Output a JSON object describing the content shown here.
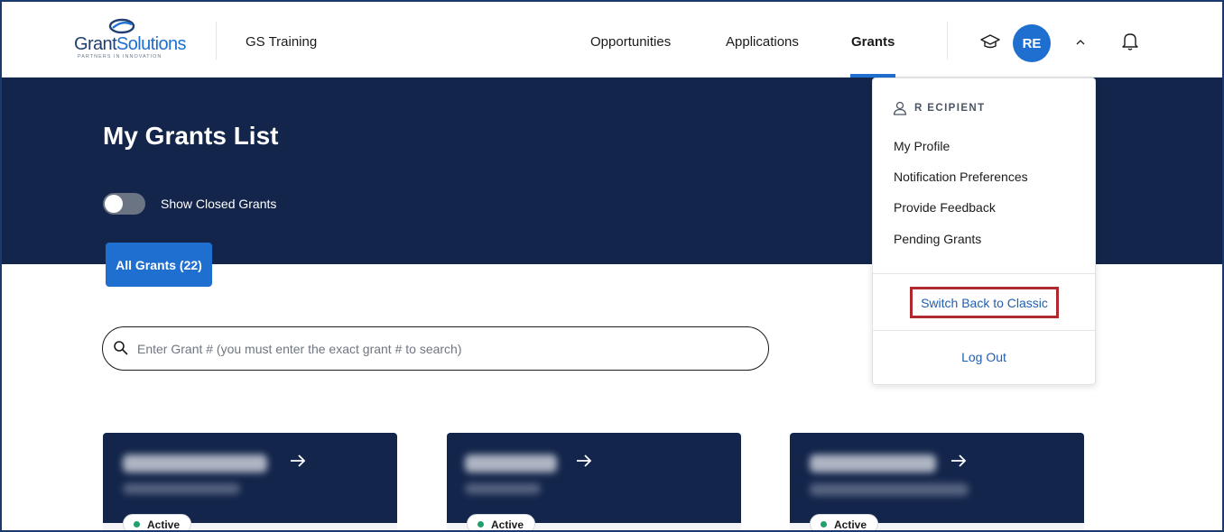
{
  "header": {
    "logo_text_a": "Grant",
    "logo_text_b": "Solutions",
    "logo_tagline": "PARTNERS IN INNOVATION",
    "app_name": "GS Training",
    "nav": [
      {
        "label": "Opportunities"
      },
      {
        "label": "Applications"
      },
      {
        "label": "Grants",
        "active": true
      }
    ],
    "avatar_initials": "RE",
    "icons": [
      "graduation-cap-icon",
      "chevron-up-icon",
      "bell-icon"
    ]
  },
  "page": {
    "title": "My Grants List",
    "toggle_label": "Show Closed Grants",
    "toggle_on": false,
    "tab_all": "All Grants (22)"
  },
  "search": {
    "placeholder": "Enter Grant # (you must enter the exact grant # to search)",
    "value": ""
  },
  "cards": [
    {
      "status": "Active"
    },
    {
      "status": "Active"
    },
    {
      "status": "Active"
    }
  ],
  "user_menu": {
    "user_name": "R ECIPIENT",
    "items": [
      {
        "label": "My Profile"
      },
      {
        "label": "Notification Preferences"
      },
      {
        "label": "Provide Feedback"
      },
      {
        "label": "Pending Grants"
      }
    ],
    "switch_label": "Switch Back to Classic",
    "logout_label": "Log Out"
  },
  "colors": {
    "primary": "#1f6fd0",
    "hero_bg": "#13254b",
    "highlight": "#b0272d",
    "status_active": "#22a06b"
  }
}
